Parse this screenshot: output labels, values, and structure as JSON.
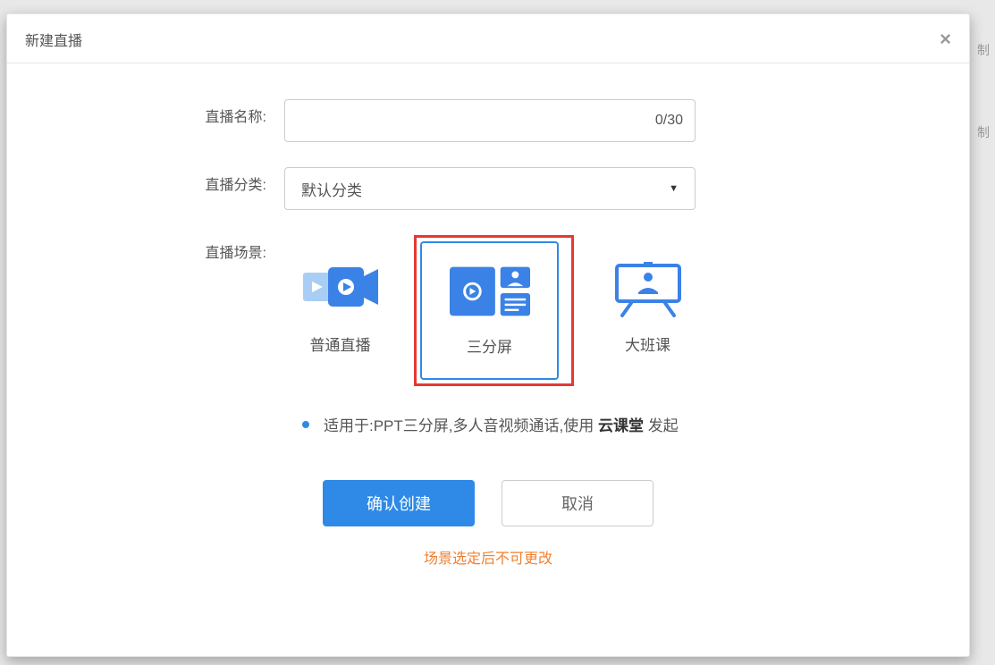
{
  "background": {
    "text_right_1": "制",
    "text_right_2": "制"
  },
  "modal": {
    "title": "新建直播",
    "close_label": "×"
  },
  "form": {
    "name_label": "直播名称:",
    "name_value": "",
    "char_count": "0/30",
    "category_label": "直播分类:",
    "category_value": "默认分类",
    "scene_label": "直播场景:",
    "scenes": [
      {
        "label": "普通直播",
        "selected": false
      },
      {
        "label": "三分屏",
        "selected": true
      },
      {
        "label": "大班课",
        "selected": false
      }
    ],
    "hint_prefix": "适用于:PPT三分屏,多人音视频通话,使用 ",
    "hint_bold": "云课堂",
    "hint_suffix": " 发起"
  },
  "buttons": {
    "confirm": "确认创建",
    "cancel": "取消"
  },
  "warning": "场景选定后不可更改"
}
